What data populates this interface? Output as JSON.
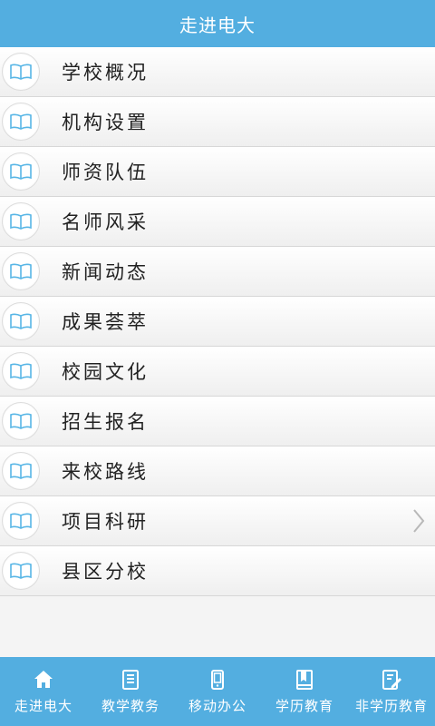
{
  "header": {
    "title": "走进电大"
  },
  "menu": {
    "items": [
      {
        "label": "学校概况",
        "icon": "book-icon"
      },
      {
        "label": "机构设置",
        "icon": "book-icon"
      },
      {
        "label": "师资队伍",
        "icon": "book-icon"
      },
      {
        "label": "名师风采",
        "icon": "book-icon"
      },
      {
        "label": "新闻动态",
        "icon": "book-icon"
      },
      {
        "label": "成果荟萃",
        "icon": "book-icon"
      },
      {
        "label": "校园文化",
        "icon": "book-icon"
      },
      {
        "label": "招生报名",
        "icon": "book-icon"
      },
      {
        "label": "来校路线",
        "icon": "book-icon"
      },
      {
        "label": "项目科研",
        "icon": "book-icon"
      },
      {
        "label": "县区分校",
        "icon": "book-icon"
      }
    ]
  },
  "tabs": [
    {
      "label": "走进电大",
      "icon": "home-icon"
    },
    {
      "label": "教学教务",
      "icon": "document-icon"
    },
    {
      "label": "移动办公",
      "icon": "phone-icon"
    },
    {
      "label": "学历教育",
      "icon": "book-icon"
    },
    {
      "label": "非学历教育",
      "icon": "edit-icon"
    }
  ],
  "colors": {
    "accent": "#53aee0",
    "icon_stroke": "#58b6e6"
  }
}
